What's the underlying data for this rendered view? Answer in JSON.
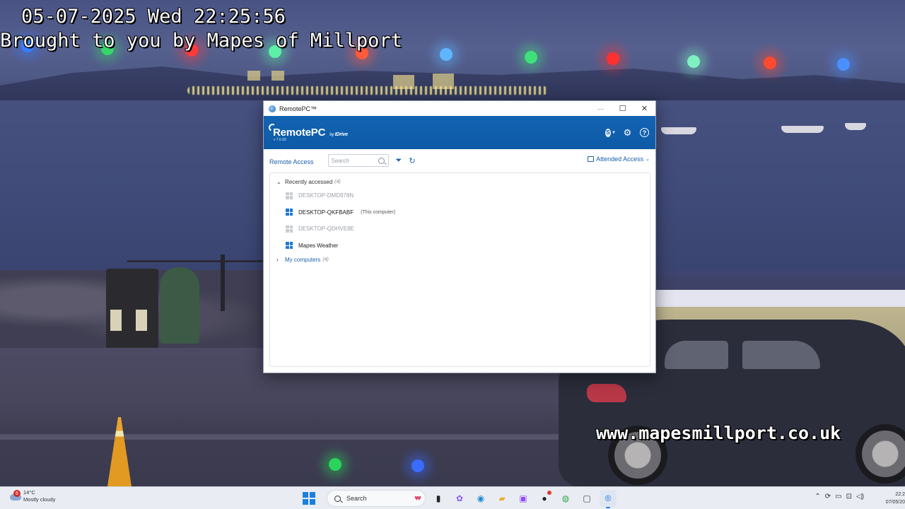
{
  "overlay": {
    "datetime": "05-07-2025 Wed 22:25:56",
    "credit": "Brought to you by Mapes of Millport",
    "url": "www.mapesmillport.co.uk"
  },
  "window": {
    "title": "RemotePC™",
    "controls": {
      "minimize": "—",
      "maximize": "☐",
      "close": "✕"
    }
  },
  "header": {
    "logo": "RemotePC",
    "logo_by": "by",
    "logo_brand": "IDrive",
    "version": "v 7.6.69",
    "account_initial": "S",
    "icons": [
      "account-icon",
      "gear-icon",
      "help-icon"
    ]
  },
  "toolbar": {
    "tab_label": "Remote Access",
    "search_placeholder": "Search",
    "attended_label": "Attended Access"
  },
  "groups": {
    "recent": {
      "label": "Recently accessed",
      "count": "(4)",
      "expanded": true,
      "items": [
        {
          "name": "DESKTOP-DMD978N",
          "status": "offline",
          "tag": ""
        },
        {
          "name": "DESKTOP-QKFBABF",
          "status": "online",
          "tag": "(This computer)"
        },
        {
          "name": "DESKTOP-QDHVE8E",
          "status": "offline",
          "tag": ""
        },
        {
          "name": "Mapes Weather",
          "status": "online",
          "tag": ""
        }
      ]
    },
    "mine": {
      "label": "My computers",
      "count": "(4)",
      "expanded": false
    }
  },
  "taskbar": {
    "weather_temp": "14°C",
    "weather_desc": "Mostly cloudy",
    "weather_badge": "6",
    "search_label": "Search",
    "clock_time": "22:2",
    "clock_date": "07/05/20",
    "accent": "#1b7fe0"
  }
}
